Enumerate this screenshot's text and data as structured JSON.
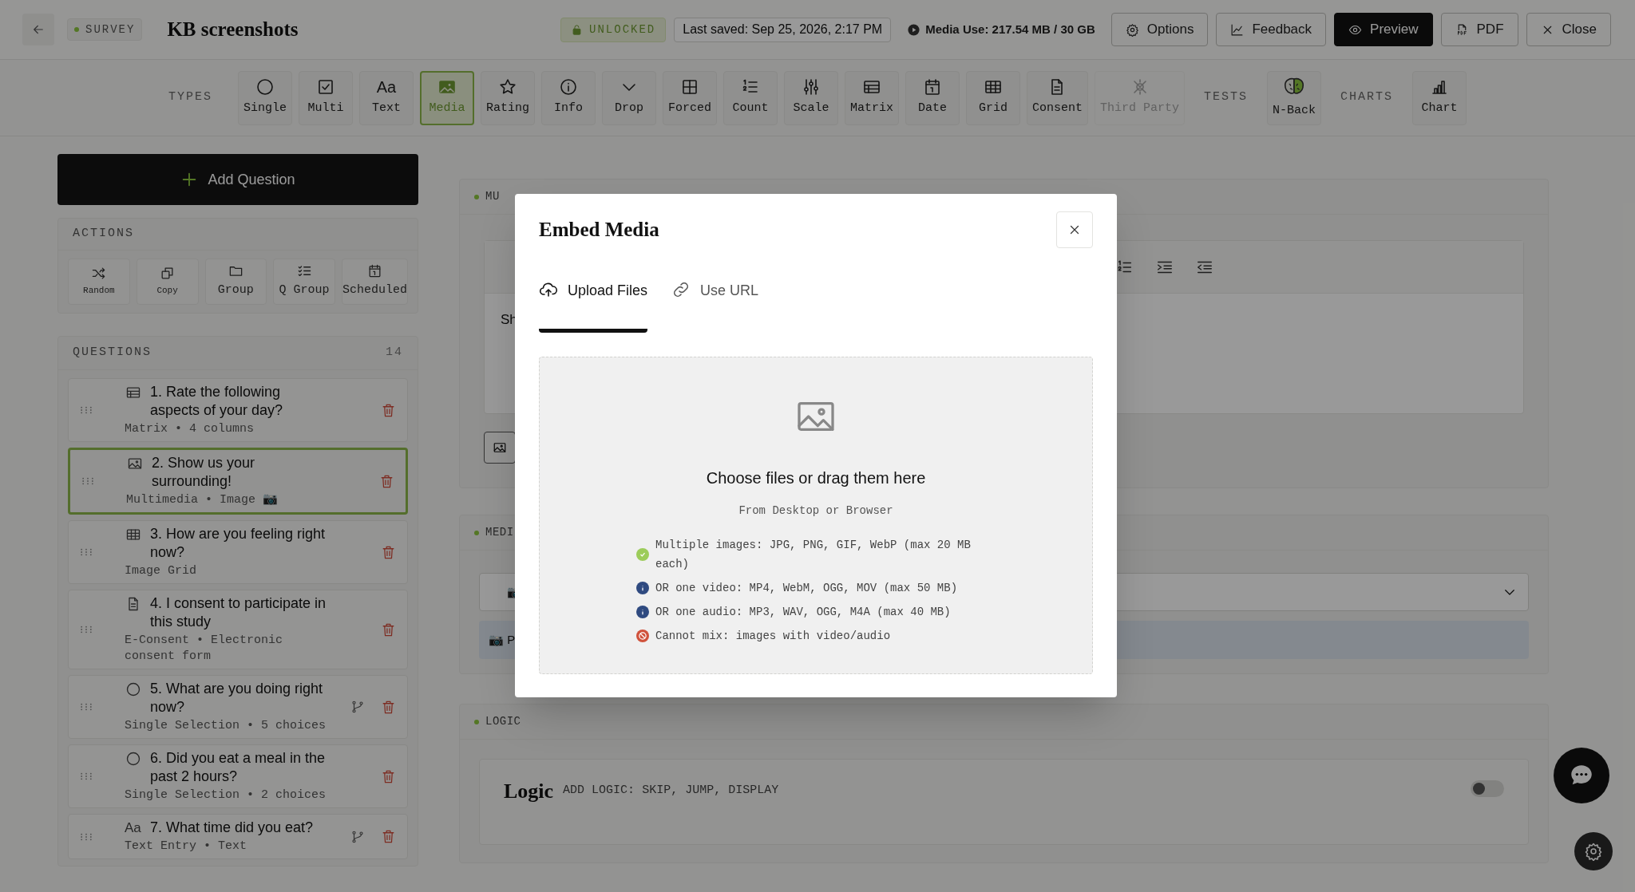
{
  "header": {
    "badge": "SURVEY",
    "title": "KB screenshots",
    "lock_status": "UNLOCKED",
    "last_saved": "Last saved: Sep 25, 2026, 2:17 PM",
    "media_use": "Media Use: 217.54 MB / 30 GB",
    "buttons": [
      {
        "label": "Options",
        "primary": false
      },
      {
        "label": "Feedback",
        "primary": false
      },
      {
        "label": "Preview",
        "primary": true
      },
      {
        "label": "PDF",
        "primary": false
      },
      {
        "label": "Close",
        "primary": false
      }
    ]
  },
  "toolbar": [
    {
      "label": "TYPES",
      "tools": [
        {
          "label": "Single",
          "kind": "single",
          "selected": false,
          "disabled": false
        },
        {
          "label": "Multi",
          "kind": "multi",
          "selected": false,
          "disabled": false
        },
        {
          "label": "Text",
          "glyph": "Aa",
          "selected": false,
          "disabled": false
        },
        {
          "label": "Media",
          "kind": "media",
          "selected": true,
          "disabled": false
        },
        {
          "label": "Rating",
          "kind": "rating",
          "selected": false,
          "disabled": false
        },
        {
          "label": "Info",
          "kind": "info",
          "selected": false,
          "disabled": false
        },
        {
          "label": "Drop",
          "kind": "dropdown",
          "selected": false,
          "disabled": false
        },
        {
          "label": "Forced",
          "kind": "forced",
          "selected": false,
          "disabled": false
        },
        {
          "label": "Count",
          "kind": "count",
          "selected": false,
          "disabled": false
        },
        {
          "label": "Scale",
          "kind": "scale",
          "selected": false,
          "disabled": false
        },
        {
          "label": "Matrix",
          "kind": "matrix",
          "selected": false,
          "disabled": false
        },
        {
          "label": "Date",
          "kind": "date",
          "selected": false,
          "disabled": false
        },
        {
          "label": "Grid",
          "kind": "grid",
          "selected": false,
          "disabled": false
        },
        {
          "label": "Consent",
          "kind": "consent",
          "selected": false,
          "disabled": false
        },
        {
          "label": "Third Party",
          "kind": "thirdparty",
          "selected": false,
          "disabled": true
        }
      ]
    },
    {
      "label": "TESTS",
      "tools": [
        {
          "label": "N-Back",
          "kind": "nback",
          "selected": false,
          "disabled": false
        }
      ]
    },
    {
      "label": "CHARTS",
      "tools": [
        {
          "label": "Chart",
          "kind": "chart",
          "selected": false,
          "disabled": false
        }
      ]
    }
  ],
  "sidebar": {
    "add_button": "Add Question",
    "actions": {
      "title": "ACTIONS",
      "items": [
        {
          "label": "Random",
          "compact": true
        },
        {
          "label": "Copy",
          "compact": true
        },
        {
          "label": "Group",
          "compact": false
        },
        {
          "label": "Q Group",
          "compact": false
        },
        {
          "label": "Scheduled",
          "compact": false
        }
      ]
    },
    "questions": {
      "title": "QUESTIONS",
      "count": "14",
      "items": [
        {
          "title": "1. Rate the following aspects of your day?",
          "meta": "Matrix • 4 columns",
          "kind": "matrix",
          "selected": false,
          "branching": false
        },
        {
          "title": "2. Show us your surrounding!",
          "meta": "Multimedia • Image 📷",
          "kind": "media",
          "selected": true,
          "branching": false
        },
        {
          "title": "3. How are you feeling right now?",
          "meta": "Image Grid",
          "kind": "grid",
          "selected": false,
          "branching": false
        },
        {
          "title": "4. I consent to participate in this study",
          "meta": "E-Consent • Electronic consent form",
          "kind": "consent",
          "selected": false,
          "branching": false
        },
        {
          "title": "5. What are you doing right now?",
          "meta": "Single Selection • 5 choices",
          "kind": "single",
          "selected": false,
          "branching": true
        },
        {
          "title": "6. Did you eat a meal in the past 2 hours?",
          "meta": "Single Selection • 2 choices",
          "kind": "single",
          "selected": false,
          "branching": false
        },
        {
          "title": "7. What time did you eat?",
          "meta": "Text Entry • Text",
          "glyph": "Aa",
          "selected": false,
          "branching": true
        }
      ]
    }
  },
  "main": {
    "multimedia_section": {
      "heading": "MU",
      "editor_text": "Sh"
    },
    "media_section": {
      "heading": "MEDI",
      "dropdown_value": "📷",
      "info_bar": "📷 P"
    },
    "logic_section": {
      "heading": "LOGIC",
      "title": "Logic",
      "subtitle": "ADD LOGIC: SKIP, JUMP, DISPLAY",
      "toggle_on": false
    }
  },
  "modal": {
    "title": "Embed Media",
    "tabs": [
      {
        "label": "Upload Files",
        "selected": true
      },
      {
        "label": "Use URL",
        "selected": false
      }
    ],
    "dropzone": {
      "heading": "Choose files or drag them here",
      "subheading": "From Desktop or Browser",
      "rules": [
        {
          "text": "Multiple images: JPG, PNG, GIF, WebP (max 20 MB each)",
          "kind": "ok"
        },
        {
          "text": "OR one video: MP4, WebM, OGG, MOV (max 50 MB)",
          "kind": "info"
        },
        {
          "text": "OR one audio: MP3, WAV, OGG, M4A (max 40 MB)",
          "kind": "info"
        },
        {
          "text": "Cannot mix: images with video/audio",
          "kind": "error"
        }
      ]
    }
  }
}
